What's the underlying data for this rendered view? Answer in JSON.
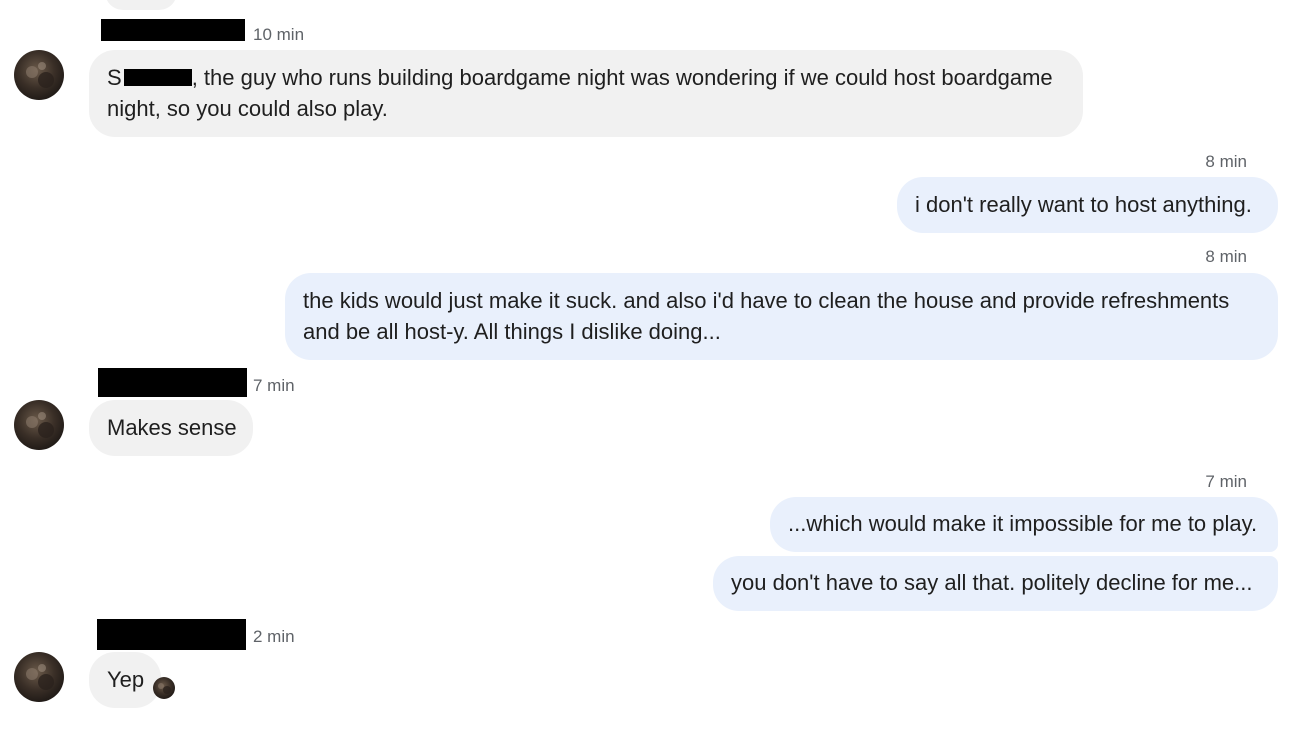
{
  "messages": [
    {
      "side": "incoming",
      "time": "10 min",
      "text_initial": "S",
      "text_after_redaction": ", the guy who runs building boardgame night was wondering if we could host boardgame",
      "text_line2": "night, so you could also play."
    },
    {
      "side": "outgoing",
      "time": "8 min",
      "text": "i don't really want to host anything."
    },
    {
      "side": "outgoing",
      "time": "8 min",
      "text_line1": "the kids would just make it suck. and also i'd have to clean the house and provide refreshments",
      "text_line2": "and be all host-y. All things I dislike doing..."
    },
    {
      "side": "incoming",
      "time": "7 min",
      "text": "Makes sense"
    },
    {
      "side": "outgoing",
      "time": "7 min",
      "text": "...which would make it impossible for me to play."
    },
    {
      "side": "outgoing",
      "text": "you don't have to say all that. politely decline for me..."
    },
    {
      "side": "incoming",
      "time": "2 min",
      "text": "Yep"
    }
  ],
  "colors": {
    "incoming_bubble": "#f1f1f1",
    "outgoing_bubble": "#e9f0fc",
    "timestamp": "#5f6368",
    "text": "#1f1f1f",
    "redaction": "#000000"
  },
  "icons": {
    "avatar": "avatar-icon",
    "read_receipt": "read-receipt-avatar-icon"
  }
}
